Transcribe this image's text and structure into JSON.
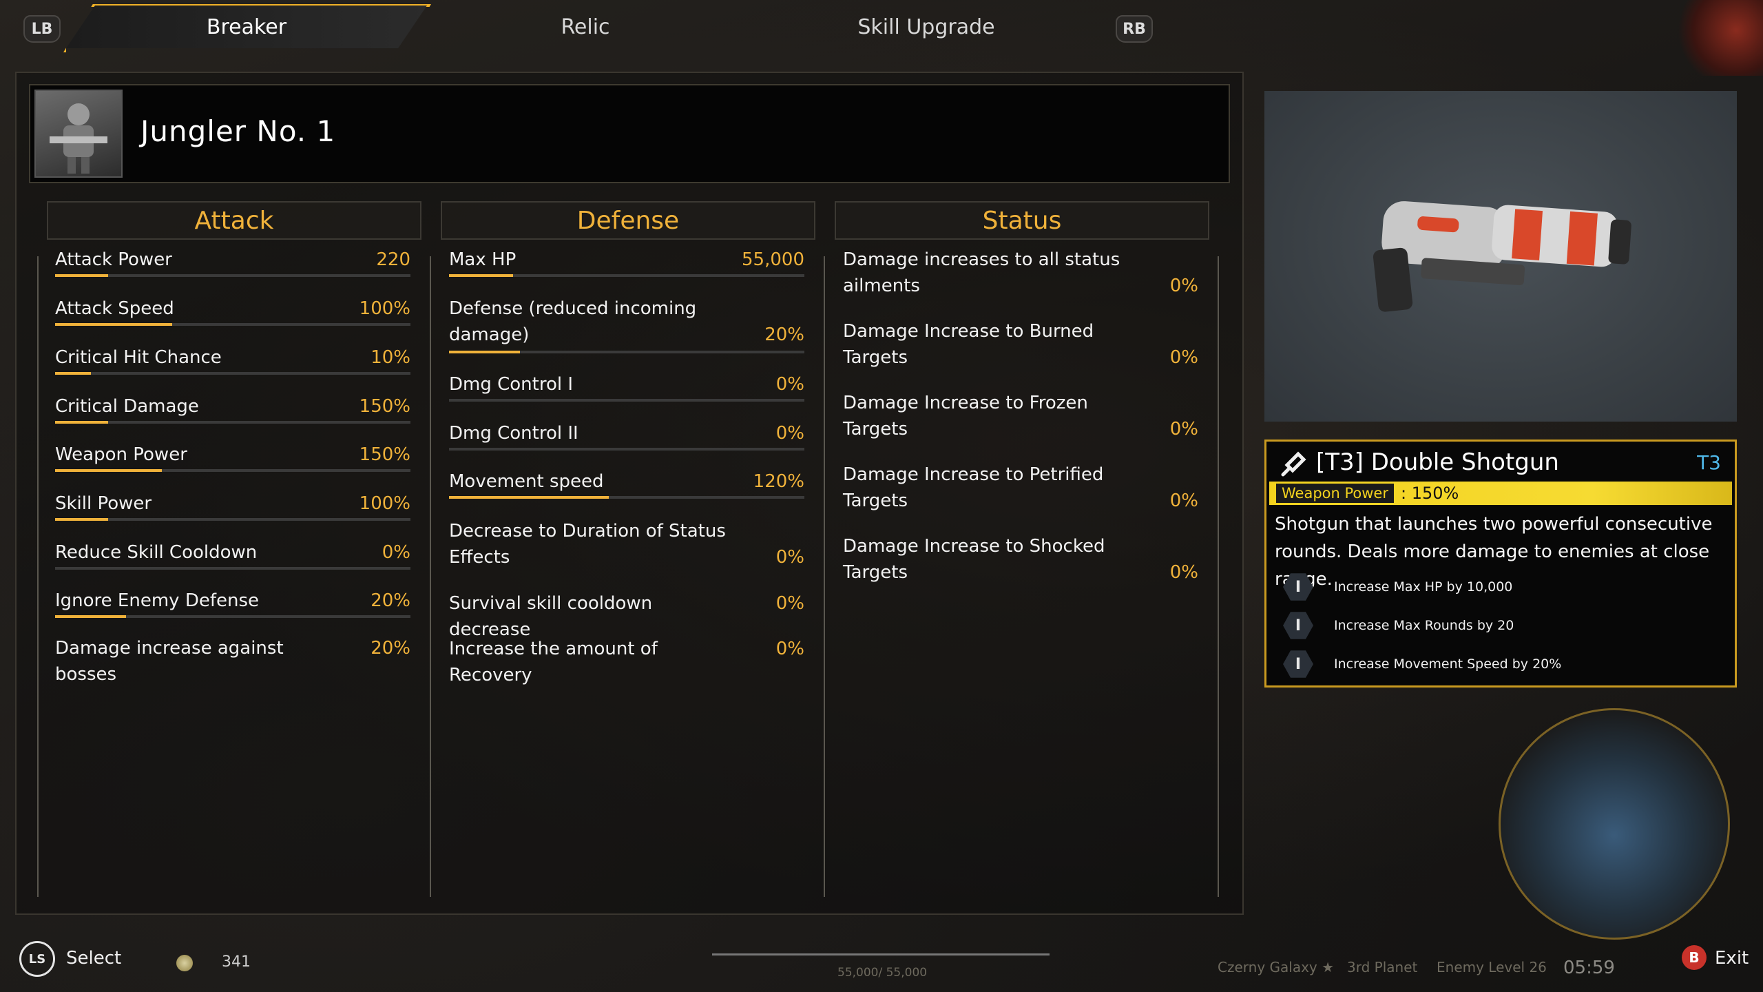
{
  "tabs": {
    "lb": "LB",
    "rb": "RB",
    "items": [
      {
        "label": "Breaker",
        "active": true
      },
      {
        "label": "Relic",
        "active": false
      },
      {
        "label": "Skill Upgrade",
        "active": false
      }
    ]
  },
  "character": {
    "name": "Jungler No. 1",
    "portrait_icon": "character-portrait"
  },
  "attack": {
    "heading": "Attack",
    "stats": [
      {
        "label": "Attack Power",
        "value": "220",
        "bar_fill": 0.15
      },
      {
        "label": "Attack Speed",
        "value": "100%",
        "bar_fill": 0.33
      },
      {
        "label": "Critical Hit Chance",
        "value": "10%",
        "bar_fill": 0.1
      },
      {
        "label": "Critical Damage",
        "value": "150%",
        "bar_fill": 0.15
      },
      {
        "label": "Weapon Power",
        "value": "150%",
        "bar_fill": 0.3
      },
      {
        "label": "Skill Power",
        "value": "100%",
        "bar_fill": 0.15
      },
      {
        "label": "Reduce Skill Cooldown",
        "value": "0%",
        "bar_fill": 0.0
      },
      {
        "label": "Ignore Enemy Defense",
        "value": "20%",
        "bar_fill": 0.2
      },
      {
        "label": "Damage increase against bosses",
        "value": "20%",
        "bar_fill": null
      }
    ]
  },
  "defense": {
    "heading": "Defense",
    "stats": [
      {
        "label": "Max HP",
        "value": "55,000",
        "bar_fill": 0.18
      },
      {
        "label": "Defense (reduced incoming damage)",
        "value": "20%",
        "bar_fill": 0.2
      },
      {
        "label": "Dmg Control I",
        "value": "0%",
        "bar_fill": 0.0
      },
      {
        "label": "Dmg Control II",
        "value": "0%",
        "bar_fill": 0.0
      },
      {
        "label": "Movement speed",
        "value": "120%",
        "bar_fill": 0.45
      },
      {
        "label": "Decrease to Duration of Status Effects",
        "value": "0%",
        "bar_fill": null
      },
      {
        "label": "Survival skill cooldown decrease",
        "value": "0%",
        "bar_fill": null
      },
      {
        "label": "Increase the amount of Recovery",
        "value": "0%",
        "bar_fill": null
      }
    ]
  },
  "status": {
    "heading": "Status",
    "stats": [
      {
        "label": "Damage increases to all status ailments",
        "value": "0%"
      },
      {
        "label": "Damage Increase to Burned Targets",
        "value": "0%"
      },
      {
        "label": "Damage Increase to Frozen Targets",
        "value": "0%"
      },
      {
        "label": "Damage Increase to Petrified Targets",
        "value": "0%"
      },
      {
        "label": "Damage Increase to Shocked Targets",
        "value": "0%"
      }
    ]
  },
  "weapon": {
    "title": "[T3] Double Shotgun",
    "tier": "T3",
    "power_label": "Weapon Power",
    "power_value": ": 150%",
    "description": "Shotgun that launches two powerful consecutive rounds. Deals more damage to enemies at close range.",
    "perks": [
      {
        "roman": "I",
        "text": "Increase Max HP by 10,000"
      },
      {
        "roman": "I",
        "text": "Increase Max Rounds by 20"
      },
      {
        "roman": "I",
        "text": "Increase Movement Speed by 20%"
      }
    ],
    "colors": {
      "accent": "#f0b23a",
      "strip": "#f3d21e",
      "tier": "#4fb7e8"
    }
  },
  "bottom": {
    "ls_key": "LS",
    "select_label": "Select",
    "currency": "341",
    "hp_readout": "55,000/ 55,000",
    "galaxy": "Czerny Galaxy ★",
    "planet": "3rd Planet",
    "enemy_level": "Enemy Level 26",
    "time": "05:59",
    "b_key": "B",
    "exit_label": "Exit"
  }
}
